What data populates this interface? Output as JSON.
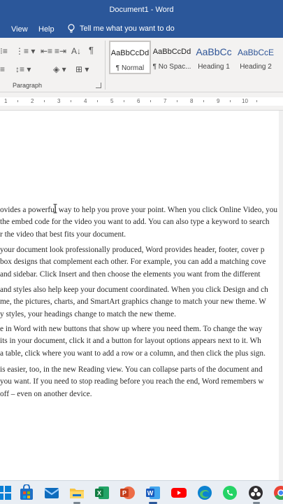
{
  "window": {
    "title": "Document1  -  Word"
  },
  "menu": {
    "tabs": [
      "View",
      "Help"
    ],
    "tell_me": "Tell me what you want to do"
  },
  "ribbon": {
    "paragraph_group_label": "Paragraph",
    "styles": [
      {
        "sample": "AaBbCcDd",
        "name": "¶ Normal",
        "selected": true
      },
      {
        "sample": "AaBbCcDd",
        "name": "¶ No Spac...",
        "selected": false
      },
      {
        "sample": "AaBbCc",
        "name": "Heading 1",
        "selected": false
      },
      {
        "sample": "AaBbCcE",
        "name": "Heading 2",
        "selected": false
      }
    ]
  },
  "ruler": {
    "numbers": [
      "1",
      "2",
      "3",
      "4",
      "5",
      "6",
      "7",
      "8",
      "9",
      "10"
    ]
  },
  "document": {
    "paragraphs": [
      [
        "ovides a powerful way to help you prove your point. When you click Online Video, you",
        "the embed code for the video you want to add. You can also type a keyword to search",
        "r the video that best fits your document."
      ],
      [
        "your document look professionally produced, Word provides header, footer, cover p",
        "box designs that complement each other. For example, you can add a matching cove",
        "and sidebar. Click Insert and then choose the elements you want from the different"
      ],
      [
        "and styles also help keep your document coordinated. When you click Design and ch",
        "me, the pictures, charts, and SmartArt graphics change to match your new theme. W",
        "y styles, your headings change to match the new theme."
      ],
      [
        "e in Word with new buttons that show up where you need them. To change the way",
        "its in your document, click it and a button for layout options appears next to it. Wh",
        "a table, click where you want to add a row or a column, and then click the plus sign."
      ],
      [
        "is easier, too, in the new Reading view. You can collapse parts of the document and",
        "you want. If you need to stop reading before you reach the end, Word remembers w",
        "off – even on another device."
      ]
    ]
  },
  "taskbar": {
    "icons": [
      "start-icon",
      "microsoft-store-icon",
      "mail-icon",
      "file-explorer-icon",
      "excel-icon",
      "powerpoint-icon",
      "word-icon",
      "youtube-icon",
      "edge-icon",
      "whatsapp-icon",
      "obs-studio-icon",
      "chrome-icon"
    ]
  },
  "colors": {
    "word_blue": "#2b579a",
    "ribbon_bg": "#f3f2f1",
    "heading_blue": "#2f5597"
  }
}
